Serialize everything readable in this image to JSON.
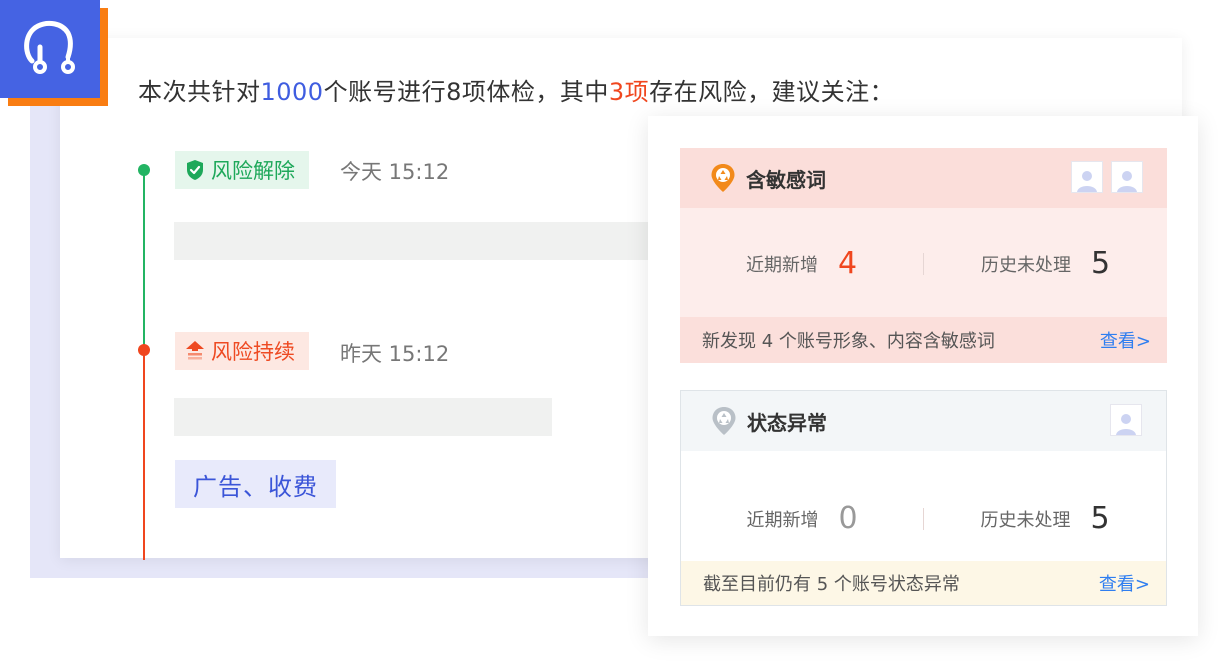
{
  "summary": {
    "prefix": "本次共针对",
    "accounts": "1000",
    "middle": "个账号进行8项体检，其中",
    "risk_count": "3项",
    "suffix": "存在风险，建议关注："
  },
  "timeline": [
    {
      "status": "风险解除",
      "time": "今天 15:12",
      "color": "#1ea85a"
    },
    {
      "status": "风险持续",
      "time": "昨天 15:12",
      "color": "#ee4a22"
    }
  ],
  "tag": {
    "label": "广告、收费"
  },
  "cards": [
    {
      "title": "含敏感词",
      "recent_label": "近期新增",
      "recent_value": "4",
      "history_label": "历史未处理",
      "history_value": "5",
      "footer_text": "新发现 4 个账号形象、内容含敏感词",
      "link": "查看>"
    },
    {
      "title": "状态异常",
      "recent_label": "近期新增",
      "recent_value": "0",
      "history_label": "历史未处理",
      "history_value": "5",
      "footer_text": "截至目前仍有 5 个账号状态异常",
      "link": "查看>"
    }
  ],
  "colors": {
    "brand_blue": "#4563e3",
    "brand_orange": "#f97d12",
    "risk_red": "#f0461e",
    "safe_green": "#23b463",
    "link_blue": "#2f7ef0"
  },
  "icons": {
    "logo": "stethoscope-icon",
    "resolved": "shield-check-icon",
    "continuing": "arrow-up-layers-icon",
    "card1": "hazard-pin-icon",
    "card2": "hazard-pin-grey-icon",
    "avatar": "user-avatar-icon"
  }
}
